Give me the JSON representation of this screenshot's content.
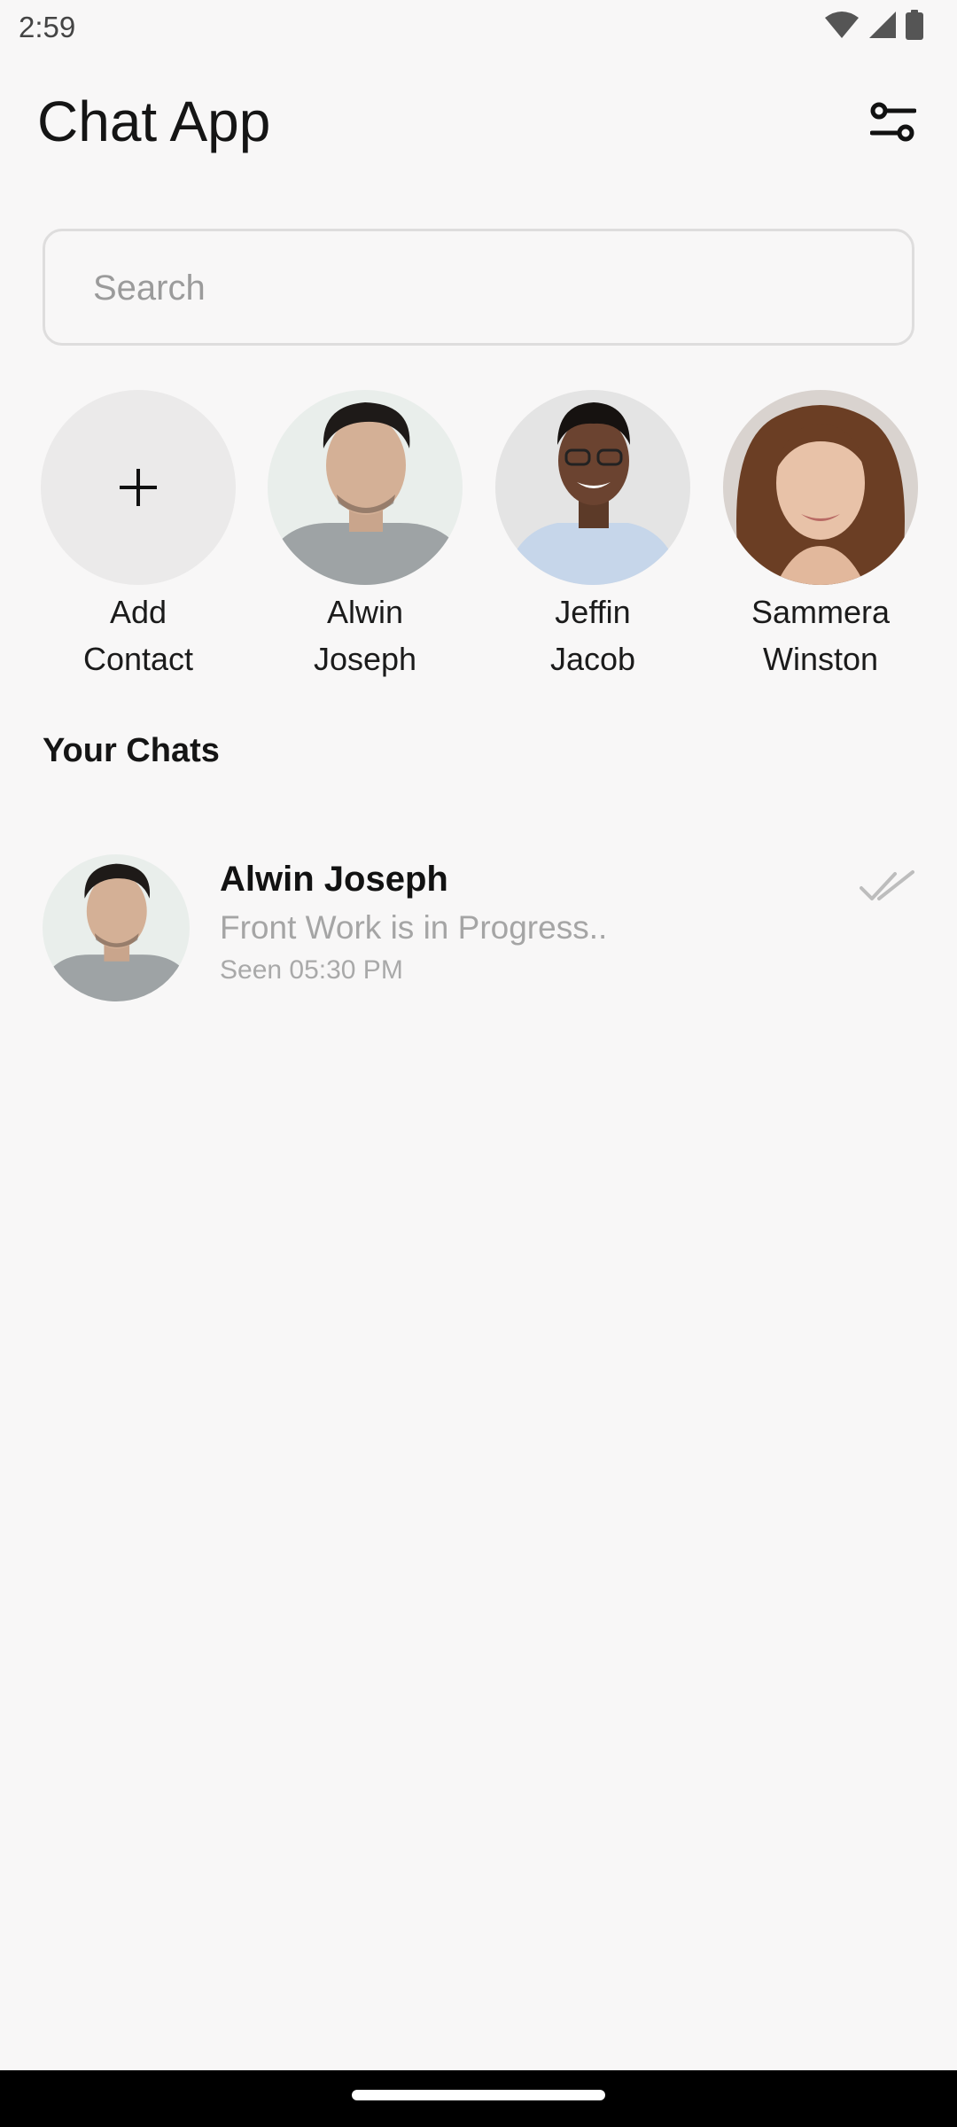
{
  "status_bar": {
    "time": "2:59",
    "icons": [
      "wifi-icon",
      "signal-icon",
      "battery-icon"
    ]
  },
  "header": {
    "title": "Chat App",
    "filter_icon": "sliders-icon"
  },
  "search": {
    "placeholder": "Search",
    "value": ""
  },
  "contacts": [
    {
      "label": "Add\nContact",
      "icon": "plus-icon"
    },
    {
      "label": "Alwin\nJoseph",
      "icon": "avatar"
    },
    {
      "label": "Jeffin\nJacob",
      "icon": "avatar"
    },
    {
      "label": "Sammera\nWinston",
      "icon": "avatar"
    }
  ],
  "chats_section": {
    "title": "Your Chats"
  },
  "chats": [
    {
      "name": "Alwin Joseph",
      "message": "Front Work is in Progress..",
      "status": "Seen 05:30 PM",
      "icon": "double-check-icon"
    }
  ],
  "colors": {
    "background": "#f8f7f7",
    "muted_text": "#a5a5a5",
    "add_contact_bg": "#ebeaea"
  }
}
